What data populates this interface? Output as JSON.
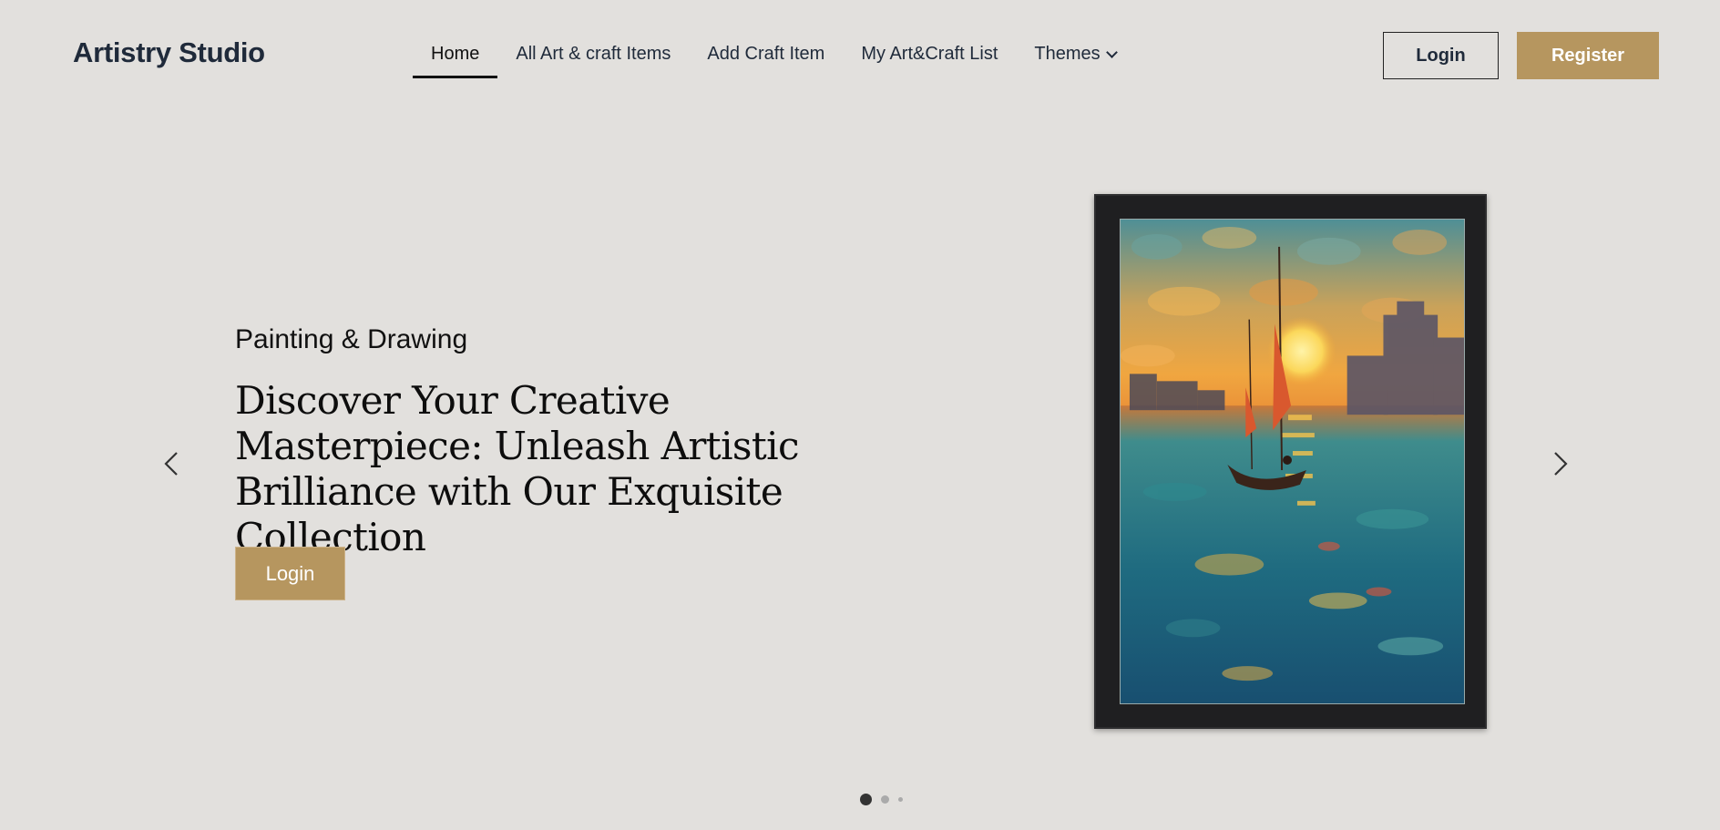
{
  "header": {
    "brand": "Artistry Studio",
    "nav": [
      {
        "label": "Home",
        "active": true
      },
      {
        "label": "All Art & craft Items",
        "active": false
      },
      {
        "label": "Add Craft Item",
        "active": false
      },
      {
        "label": "My Art&Craft List",
        "active": false
      },
      {
        "label": "Themes",
        "active": false,
        "dropdown": true,
        "icon": "chevron-down-icon"
      }
    ],
    "login_label": "Login",
    "register_label": "Register"
  },
  "hero": {
    "kicker": "Painting & Drawing",
    "title": "Discover Your Creative Masterpiece: Unleash Artistic Brilliance with Our Exquisite Collection",
    "cta_label": "Login",
    "prev_icon": "chevron-left-icon",
    "next_icon": "chevron-right-icon",
    "image_subject": "framed painting of a sailboat at sunset",
    "slides_total": 3,
    "active_slide": 1
  },
  "colors": {
    "background": "#e2e0dd",
    "accent": "#b6965f",
    "text": "#1f2a3a"
  }
}
